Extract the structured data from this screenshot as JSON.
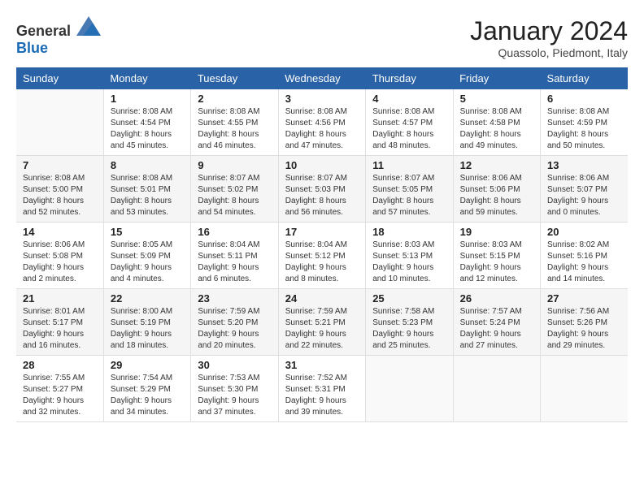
{
  "header": {
    "logo_general": "General",
    "logo_blue": "Blue",
    "month_title": "January 2024",
    "location": "Quassolo, Piedmont, Italy"
  },
  "weekdays": [
    "Sunday",
    "Monday",
    "Tuesday",
    "Wednesday",
    "Thursday",
    "Friday",
    "Saturday"
  ],
  "weeks": [
    [
      {
        "day": "",
        "info": ""
      },
      {
        "day": "1",
        "info": "Sunrise: 8:08 AM\nSunset: 4:54 PM\nDaylight: 8 hours\nand 45 minutes."
      },
      {
        "day": "2",
        "info": "Sunrise: 8:08 AM\nSunset: 4:55 PM\nDaylight: 8 hours\nand 46 minutes."
      },
      {
        "day": "3",
        "info": "Sunrise: 8:08 AM\nSunset: 4:56 PM\nDaylight: 8 hours\nand 47 minutes."
      },
      {
        "day": "4",
        "info": "Sunrise: 8:08 AM\nSunset: 4:57 PM\nDaylight: 8 hours\nand 48 minutes."
      },
      {
        "day": "5",
        "info": "Sunrise: 8:08 AM\nSunset: 4:58 PM\nDaylight: 8 hours\nand 49 minutes."
      },
      {
        "day": "6",
        "info": "Sunrise: 8:08 AM\nSunset: 4:59 PM\nDaylight: 8 hours\nand 50 minutes."
      }
    ],
    [
      {
        "day": "7",
        "info": "Sunrise: 8:08 AM\nSunset: 5:00 PM\nDaylight: 8 hours\nand 52 minutes."
      },
      {
        "day": "8",
        "info": "Sunrise: 8:08 AM\nSunset: 5:01 PM\nDaylight: 8 hours\nand 53 minutes."
      },
      {
        "day": "9",
        "info": "Sunrise: 8:07 AM\nSunset: 5:02 PM\nDaylight: 8 hours\nand 54 minutes."
      },
      {
        "day": "10",
        "info": "Sunrise: 8:07 AM\nSunset: 5:03 PM\nDaylight: 8 hours\nand 56 minutes."
      },
      {
        "day": "11",
        "info": "Sunrise: 8:07 AM\nSunset: 5:05 PM\nDaylight: 8 hours\nand 57 minutes."
      },
      {
        "day": "12",
        "info": "Sunrise: 8:06 AM\nSunset: 5:06 PM\nDaylight: 8 hours\nand 59 minutes."
      },
      {
        "day": "13",
        "info": "Sunrise: 8:06 AM\nSunset: 5:07 PM\nDaylight: 9 hours\nand 0 minutes."
      }
    ],
    [
      {
        "day": "14",
        "info": "Sunrise: 8:06 AM\nSunset: 5:08 PM\nDaylight: 9 hours\nand 2 minutes."
      },
      {
        "day": "15",
        "info": "Sunrise: 8:05 AM\nSunset: 5:09 PM\nDaylight: 9 hours\nand 4 minutes."
      },
      {
        "day": "16",
        "info": "Sunrise: 8:04 AM\nSunset: 5:11 PM\nDaylight: 9 hours\nand 6 minutes."
      },
      {
        "day": "17",
        "info": "Sunrise: 8:04 AM\nSunset: 5:12 PM\nDaylight: 9 hours\nand 8 minutes."
      },
      {
        "day": "18",
        "info": "Sunrise: 8:03 AM\nSunset: 5:13 PM\nDaylight: 9 hours\nand 10 minutes."
      },
      {
        "day": "19",
        "info": "Sunrise: 8:03 AM\nSunset: 5:15 PM\nDaylight: 9 hours\nand 12 minutes."
      },
      {
        "day": "20",
        "info": "Sunrise: 8:02 AM\nSunset: 5:16 PM\nDaylight: 9 hours\nand 14 minutes."
      }
    ],
    [
      {
        "day": "21",
        "info": "Sunrise: 8:01 AM\nSunset: 5:17 PM\nDaylight: 9 hours\nand 16 minutes."
      },
      {
        "day": "22",
        "info": "Sunrise: 8:00 AM\nSunset: 5:19 PM\nDaylight: 9 hours\nand 18 minutes."
      },
      {
        "day": "23",
        "info": "Sunrise: 7:59 AM\nSunset: 5:20 PM\nDaylight: 9 hours\nand 20 minutes."
      },
      {
        "day": "24",
        "info": "Sunrise: 7:59 AM\nSunset: 5:21 PM\nDaylight: 9 hours\nand 22 minutes."
      },
      {
        "day": "25",
        "info": "Sunrise: 7:58 AM\nSunset: 5:23 PM\nDaylight: 9 hours\nand 25 minutes."
      },
      {
        "day": "26",
        "info": "Sunrise: 7:57 AM\nSunset: 5:24 PM\nDaylight: 9 hours\nand 27 minutes."
      },
      {
        "day": "27",
        "info": "Sunrise: 7:56 AM\nSunset: 5:26 PM\nDaylight: 9 hours\nand 29 minutes."
      }
    ],
    [
      {
        "day": "28",
        "info": "Sunrise: 7:55 AM\nSunset: 5:27 PM\nDaylight: 9 hours\nand 32 minutes."
      },
      {
        "day": "29",
        "info": "Sunrise: 7:54 AM\nSunset: 5:29 PM\nDaylight: 9 hours\nand 34 minutes."
      },
      {
        "day": "30",
        "info": "Sunrise: 7:53 AM\nSunset: 5:30 PM\nDaylight: 9 hours\nand 37 minutes."
      },
      {
        "day": "31",
        "info": "Sunrise: 7:52 AM\nSunset: 5:31 PM\nDaylight: 9 hours\nand 39 minutes."
      },
      {
        "day": "",
        "info": ""
      },
      {
        "day": "",
        "info": ""
      },
      {
        "day": "",
        "info": ""
      }
    ]
  ]
}
